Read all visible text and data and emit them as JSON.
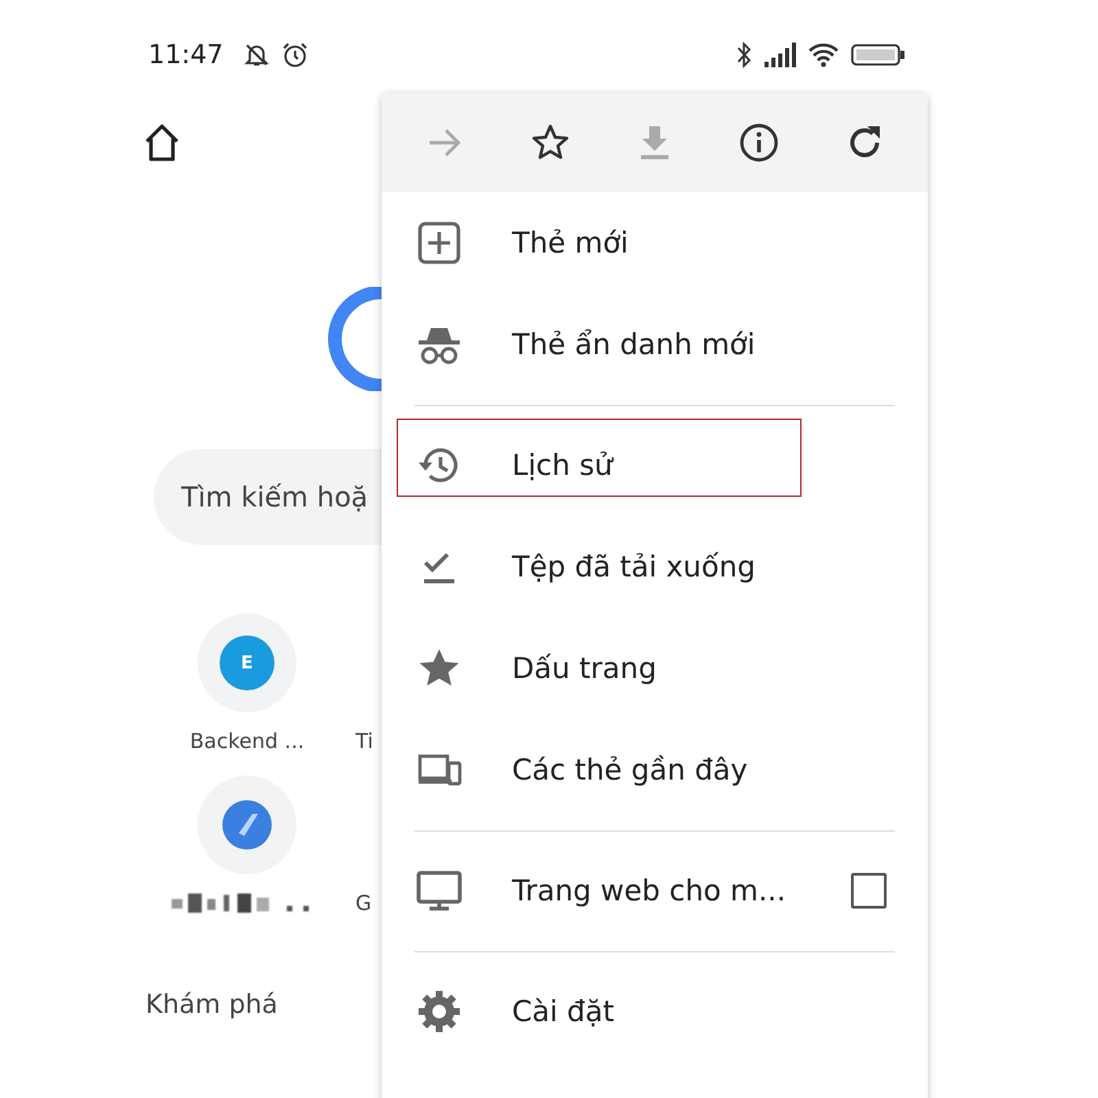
{
  "status_bar": {
    "time": "11:47"
  },
  "search": {
    "placeholder": "Tìm kiếm hoặ"
  },
  "shortcuts": [
    {
      "label": "Backend ...",
      "letter": "E",
      "kind": "letter"
    },
    {
      "label": "Ti",
      "kind": "hidden"
    },
    {
      "kind": "blurred"
    },
    {
      "label": "G",
      "kind": "hidden"
    }
  ],
  "discover": {
    "title": "Khám phá"
  },
  "menu": {
    "toolbar": [
      {
        "kind": "forward",
        "disabled": true
      },
      {
        "kind": "star",
        "disabled": false
      },
      {
        "kind": "download",
        "disabled": true
      },
      {
        "kind": "info",
        "disabled": false
      },
      {
        "kind": "reload",
        "disabled": false
      }
    ],
    "items": [
      {
        "kind": "item",
        "label": "Thẻ mới",
        "highlighted": false
      },
      {
        "kind": "item",
        "label": "Thẻ ẩn danh mới",
        "highlighted": false
      },
      {
        "kind": "divider"
      },
      {
        "kind": "item",
        "label": "Lịch sử",
        "highlighted": true
      },
      {
        "kind": "item",
        "label": "Tệp đã tải xuống",
        "highlighted": false
      },
      {
        "kind": "item",
        "label": "Dấu trang",
        "highlighted": false
      },
      {
        "kind": "item",
        "label": "Các thẻ gần đây",
        "highlighted": false
      },
      {
        "kind": "divider"
      },
      {
        "kind": "check",
        "label": "Trang web cho m...",
        "checked": false,
        "highlighted": false
      },
      {
        "kind": "divider"
      },
      {
        "kind": "item",
        "label": "Cài đặt",
        "highlighted": false
      }
    ]
  }
}
